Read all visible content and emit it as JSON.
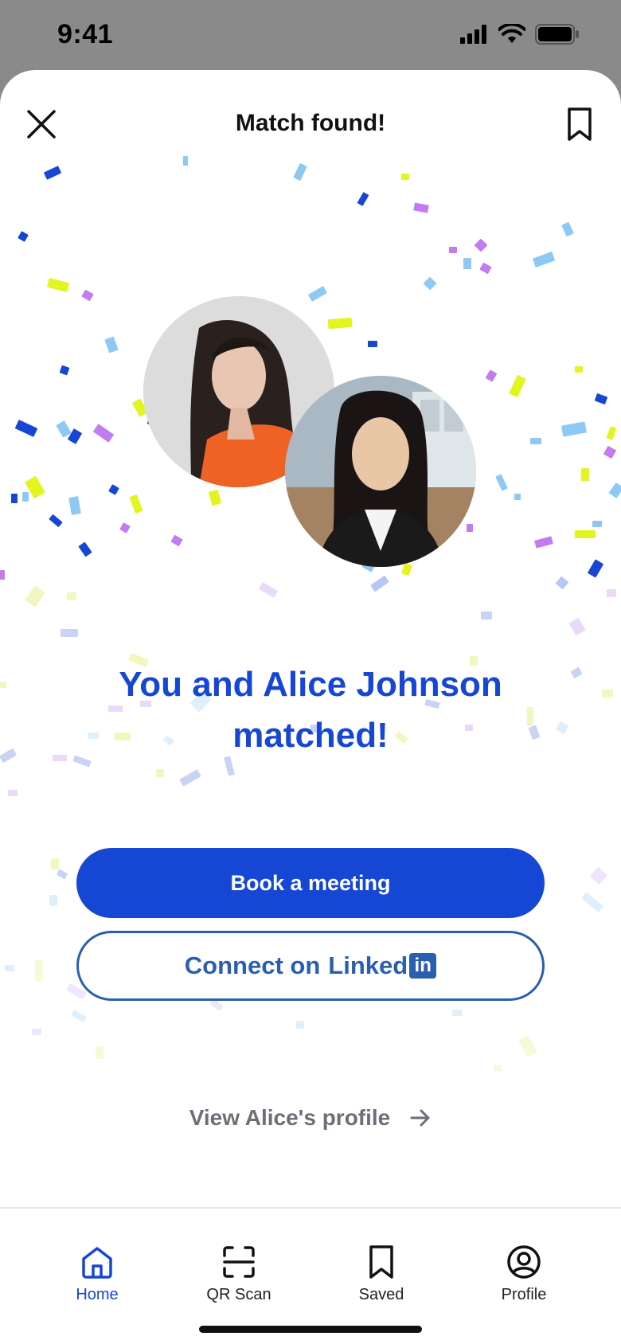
{
  "status_bar": {
    "time": "9:41",
    "icons": [
      "signal-icon",
      "wifi-icon",
      "battery-icon"
    ]
  },
  "header": {
    "title": "Match found!",
    "close_icon": "close-icon",
    "save_icon": "bookmark-icon"
  },
  "match": {
    "headline_line1": "You and Alice Johnson",
    "headline_line2": "matched!",
    "avatars": [
      "avatar-user",
      "avatar-alice"
    ]
  },
  "actions": {
    "book_label": "Book a meeting",
    "connect_prefix": "Connect on",
    "connect_brand_text": "Linked",
    "connect_brand_mark": "in",
    "view_profile_label": "View Alice's profile",
    "view_profile_icon": "arrow-right-icon"
  },
  "tabs": [
    {
      "label": "Home",
      "icon": "home-icon",
      "active": true
    },
    {
      "label": "QR Scan",
      "icon": "qr-scan-icon",
      "active": false
    },
    {
      "label": "Saved",
      "icon": "bookmark-icon",
      "active": false
    },
    {
      "label": "Profile",
      "icon": "profile-icon",
      "active": false
    }
  ],
  "colors": {
    "accent": "#1646D4",
    "linkedin": "#2A5FB0",
    "confetti": [
      "#1646D4",
      "#8EC8F5",
      "#C27CF0",
      "#E3F520"
    ]
  }
}
